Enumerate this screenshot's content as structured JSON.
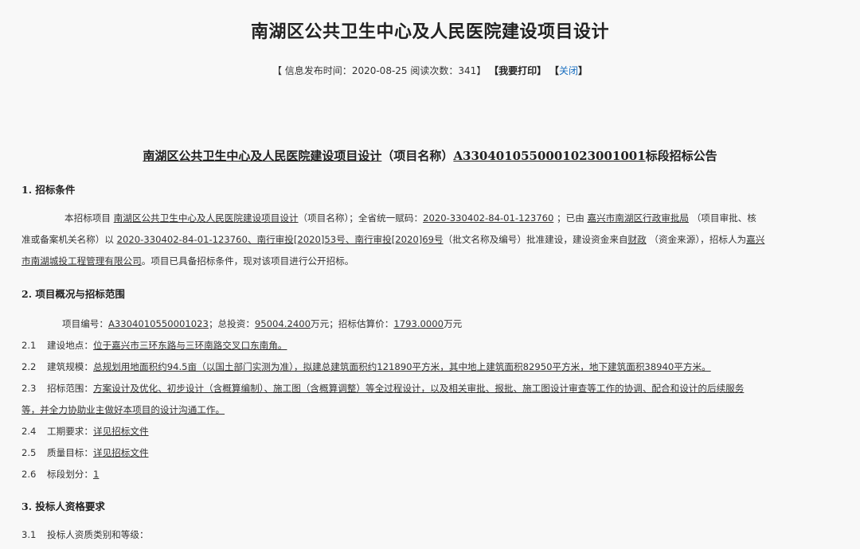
{
  "page_title": "南湖区公共卫生中心及人民医院建设项目设计",
  "meta": {
    "open_bracket": "【",
    "publish_label": "信息发布时间：",
    "publish_date": "2020-08-25",
    "read_label": "阅读次数：",
    "read_count": "341",
    "close_bracket": "】",
    "print_label": "【我要打印】",
    "close_open": "【",
    "close_label": "关闭",
    "close_close": "】"
  },
  "notice": {
    "project_name": "南湖区公共卫生中心及人民医院建设项目设计",
    "name_note": "（项目名称）",
    "section_code": "A330401055000102300100​1",
    "suffix": "标段招标公告"
  },
  "s1": {
    "title": "1. 招标条件",
    "l1": {
      "a": "本招标项目 ",
      "b": "南湖区公共卫生中心及人民医院建设项目设计",
      "c": "（项目名称）；全省统一赋码：",
      "d": "2020-330402-84-01-123760",
      "e": " ；已由 ",
      "f": "嘉兴市南湖区行政审批局",
      "g": " （项目审批、核"
    },
    "l2": {
      "a": "准或备案机关名称）以 ",
      "b": "2020-330402-84-01-123760、南行审投[2020]53号、南行审投[2020]69号",
      "c": "（批文名称及编号）批准建设，建设资金来自",
      "d": "财政",
      "e": " （资金来源），招标人为",
      "f": "嘉兴"
    },
    "l3": {
      "a": "市南湖城投工程管理有限公司",
      "b": "。项目已具备招标条件，现对该项目进行公开招标。"
    }
  },
  "s2": {
    "title": "2. 项目概况与招标范围",
    "l0": {
      "a": "项目编号：",
      "b": "A3304010550001023",
      "c": "；总投资：",
      "d": "95004.2400",
      "e": "万元；招标估算价：",
      "f": "1793.0000",
      "g": "万元"
    },
    "items": {
      "i1": {
        "num": "2.1",
        "label": "建设地点：",
        "value": "位于嘉兴市三环东路与三环南路交叉口东南角。"
      },
      "i2": {
        "num": "2.2",
        "label": "建筑规模：",
        "value": "总规划用地面积约94.5亩（以国土部门实测为准），拟建总建筑面积约121890平方米，其中地上建筑面积82950平方米，地下建筑面积38940平方米。"
      },
      "i3": {
        "num": "2.3",
        "label": "招标范围：",
        "value": "方案设计及优化、初步设计（含概算编制）、施工图（含概算调整）等全过程设计，以及相关审批、报批、施工图设计审查等工作的协调、配合和设计的后续服务",
        "value2": "等，并全力协助业主做好本项目的设计沟通工作。"
      },
      "i4": {
        "num": "2.4",
        "label": "工期要求：",
        "value": "详见招标文件"
      },
      "i5": {
        "num": "2.5",
        "label": "质量目标：",
        "value": "详见招标文件"
      },
      "i6": {
        "num": "2.6",
        "label": "标段划分：",
        "value": "1"
      }
    }
  },
  "s3": {
    "title": "3. 投标人资格要求",
    "i1": {
      "num": "3.1",
      "label": "投标人资质类别和等级："
    }
  }
}
